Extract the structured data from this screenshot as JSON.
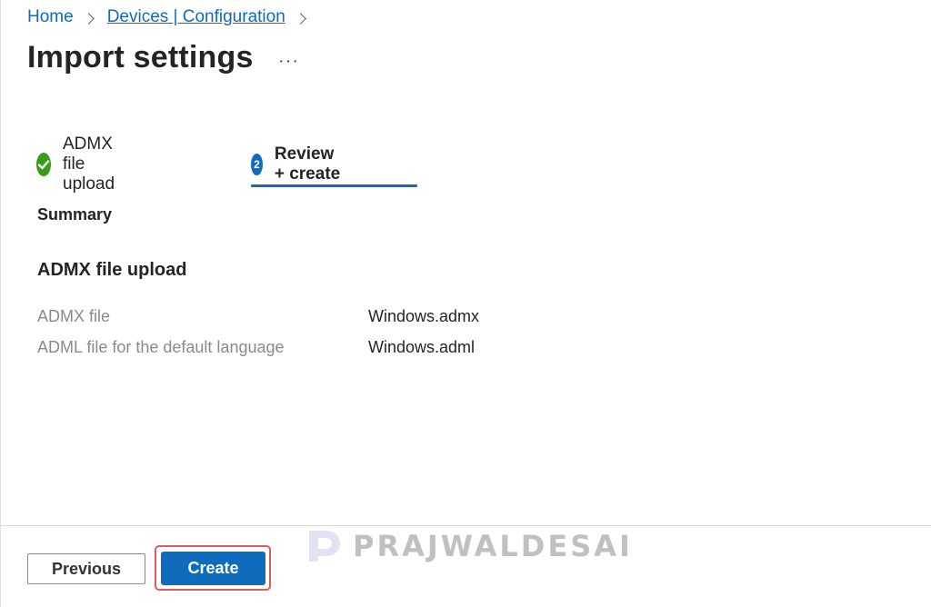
{
  "breadcrumb": {
    "home": "Home",
    "section": "Devices | Configuration"
  },
  "page": {
    "title": "Import settings",
    "more": "···"
  },
  "steps": [
    {
      "label": "ADMX file upload",
      "status": "completed"
    },
    {
      "number": "2",
      "label": "Review + create",
      "status": "active"
    }
  ],
  "summary": {
    "heading": "Summary",
    "section_title": "ADMX file upload",
    "rows": [
      {
        "label": "ADMX file",
        "value": "Windows.admx"
      },
      {
        "label": "ADML file for the default language",
        "value": "Windows.adml"
      }
    ]
  },
  "footer": {
    "previous_label": "Previous",
    "create_label": "Create"
  },
  "watermark": {
    "text": "PRAJWALDESAI"
  },
  "colors": {
    "accent": "#0f6cbd",
    "success": "#3b9b1b",
    "highlight": "#e05a5a"
  }
}
